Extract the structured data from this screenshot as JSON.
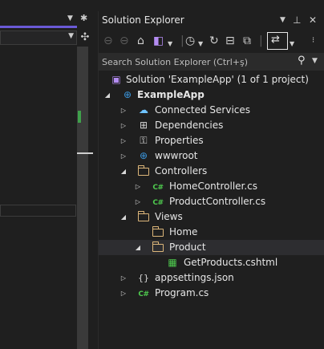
{
  "panel": {
    "title": "Solution Explorer",
    "search_placeholder": "Search Solution Explorer (Ctrl+ş)"
  },
  "icons": {
    "dropdown": "chevron-down-icon",
    "pin": "pin-icon",
    "close": "close-icon",
    "search": "search-icon"
  },
  "colors": {
    "accent": "#6a5ad6",
    "folder": "#dcb67a",
    "csharp": "#4ec94e",
    "globe": "#3a96dd",
    "selection": "#2d2d30"
  },
  "tree": [
    {
      "label": "Solution 'ExampleApp' (1 of 1 project)",
      "level": 0,
      "expander": "none",
      "icon": "solution-icon",
      "bold": false
    },
    {
      "label": "ExampleApp",
      "level": 0,
      "expander": "expanded",
      "icon": "web-project-icon",
      "bold": true
    },
    {
      "label": "Connected Services",
      "level": 1,
      "expander": "collapsed",
      "icon": "connected-services-icon",
      "bold": false
    },
    {
      "label": "Dependencies",
      "level": 1,
      "expander": "collapsed",
      "icon": "dependencies-icon",
      "bold": false
    },
    {
      "label": "Properties",
      "level": 1,
      "expander": "collapsed",
      "icon": "properties-icon",
      "bold": false
    },
    {
      "label": "wwwroot",
      "level": 1,
      "expander": "collapsed",
      "icon": "globe-icon",
      "bold": false
    },
    {
      "label": "Controllers",
      "level": 1,
      "expander": "expanded",
      "icon": "folder-open-icon",
      "bold": false
    },
    {
      "label": "HomeController.cs",
      "level": 2,
      "expander": "collapsed",
      "icon": "csharp-file-icon",
      "bold": false
    },
    {
      "label": "ProductController.cs",
      "level": 2,
      "expander": "collapsed",
      "icon": "csharp-file-icon",
      "bold": false
    },
    {
      "label": "Views",
      "level": 1,
      "expander": "expanded",
      "icon": "folder-open-icon",
      "bold": false
    },
    {
      "label": "Home",
      "level": 2,
      "expander": "none",
      "icon": "folder-icon",
      "bold": false
    },
    {
      "label": "Product",
      "level": 2,
      "expander": "expanded",
      "icon": "folder-open-icon",
      "bold": false,
      "selected": true
    },
    {
      "label": "GetProducts.cshtml",
      "level": 3,
      "expander": "none",
      "icon": "cshtml-file-icon",
      "bold": false
    },
    {
      "label": "appsettings.json",
      "level": 1,
      "expander": "collapsed",
      "icon": "json-file-icon",
      "bold": false
    },
    {
      "label": "Program.cs",
      "level": 1,
      "expander": "collapsed",
      "icon": "csharp-file-icon",
      "bold": false
    }
  ]
}
